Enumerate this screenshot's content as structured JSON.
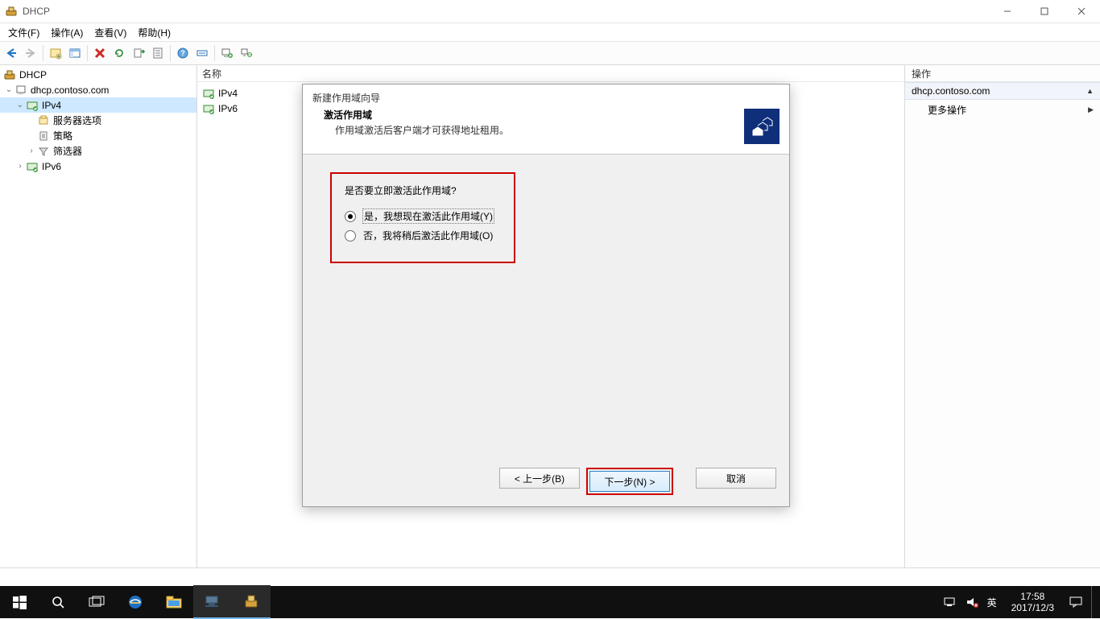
{
  "window": {
    "title": "DHCP"
  },
  "menu": {
    "file": "文件(F)",
    "action": "操作(A)",
    "view": "查看(V)",
    "help": "帮助(H)"
  },
  "tree": {
    "root": "DHCP",
    "server": "dhcp.contoso.com",
    "ipv4": "IPv4",
    "server_options": "服务器选项",
    "policy": "策略",
    "filter": "筛选器",
    "ipv6": "IPv6"
  },
  "content": {
    "header": "名称",
    "items": [
      "IPv4",
      "IPv6"
    ]
  },
  "actions": {
    "header": "操作",
    "group": "dhcp.contoso.com",
    "more": "更多操作"
  },
  "wizard": {
    "title": "新建作用域向导",
    "heading": "激活作用域",
    "sub": "作用域激活后客户端才可获得地址租用。",
    "question": "是否要立即激活此作用域?",
    "opt_yes": "是，我想现在激活此作用域(Y)",
    "opt_no": "否，我将稍后激活此作用域(O)",
    "back": "< 上一步(B)",
    "next": "下一步(N) >",
    "cancel": "取消"
  },
  "tray": {
    "ime": "英",
    "time": "17:58",
    "date": "2017/12/3"
  }
}
